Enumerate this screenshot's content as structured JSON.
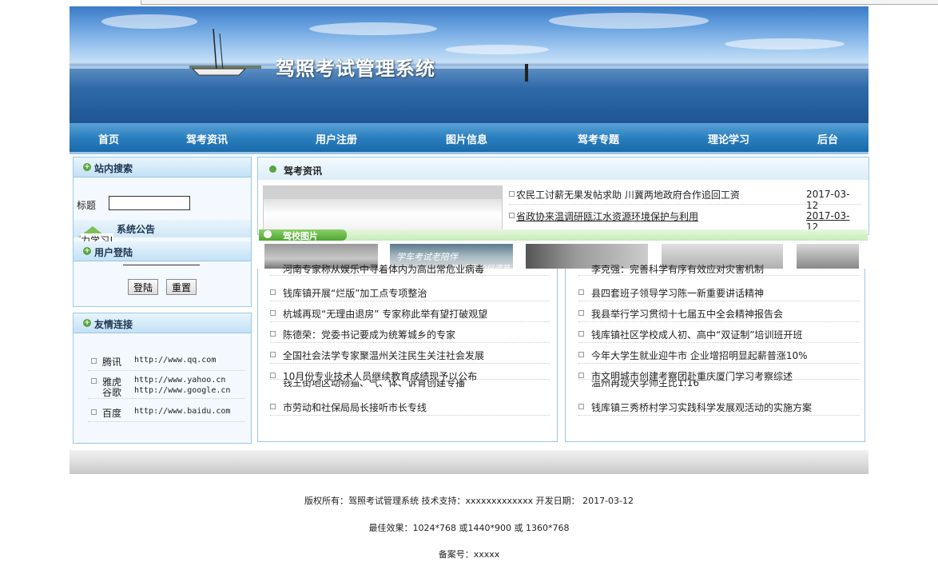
{
  "banner": {
    "title": "驾照考试管理系统"
  },
  "nav": [
    "首页",
    "驾考资讯",
    "用户注册",
    "图片信息",
    "驾考专题",
    "理论学习",
    "后台"
  ],
  "search": {
    "title": "站内搜索",
    "label": "标题"
  },
  "notice": {
    "title": "系统公告",
    "text": "力学习!"
  },
  "login": {
    "title": "用户登陆",
    "login_btn": "登陆",
    "reset_btn": "重置"
  },
  "links": {
    "title": "友情连接",
    "items": [
      {
        "name": "腾讯",
        "url": "http://www.qq.com"
      },
      {
        "name": "雅虎",
        "url": "http://www.yahoo.cn"
      },
      {
        "name": "谷歌",
        "url": "http://www.google.cn"
      },
      {
        "name": "百度",
        "url": "http://www.baidu.com"
      }
    ]
  },
  "news": {
    "title": "驾考资讯",
    "top": [
      {
        "text": "农民工讨薪无果发帖求助 川冀两地政府合作追回工资",
        "date": "2017-03-12"
      },
      {
        "text": "省政协来温调研瓯江水资源环境保护与利用",
        "date": "2017-03-12"
      }
    ]
  },
  "photos": {
    "title": "驾校图片",
    "overlay": "学车考试老陪伴",
    "overlay2": "驾驶心情如何调节"
  },
  "left_list": [
    "河南专家称从娱乐中寻着体内为高出常危业病毒",
    "钱库镇开展“烂版”加工点专项整治",
    "杭城再现“无理由退房” 专家称此举有望打破观望",
    "陈德荣：党委书记要成为统筹城乡的专家",
    "全国社会法学专家聚温州关注民生关注社会发展",
    "10月份专业技术人员继续教育成绩现予以公布",
    "钱王街地区动物猫、气、体、诉育创建专播",
    "市劳动和社保局局长接听市长专线"
  ],
  "right_list": [
    "李克强：完善科学有序有效应对灾害机制",
    "县四套班子领导学习陈一新重要讲话精神",
    "我县举行学习贯彻十七届五中全会精神报告会",
    "钱库镇社区学校成人初、高中“双证制”培训班开班",
    "今年大学生就业迎牛市 企业增招明显起薪普涨10%",
    "市文明城市创建考察团赴重庆厦门学习考察综述",
    "温州再现大学师生比1:16",
    "钱库镇三秀桥村学习实践科学发展观活动的实施方案"
  ],
  "footer": {
    "line1": "版权所有：驾照考试管理系统 技术支持：xxxxxxxxxxxxx 开发日期： 2017-03-12",
    "line2": "最佳效果：1024*768 或1440*900 或 1360*768",
    "line3": "备案号：xxxxx"
  }
}
